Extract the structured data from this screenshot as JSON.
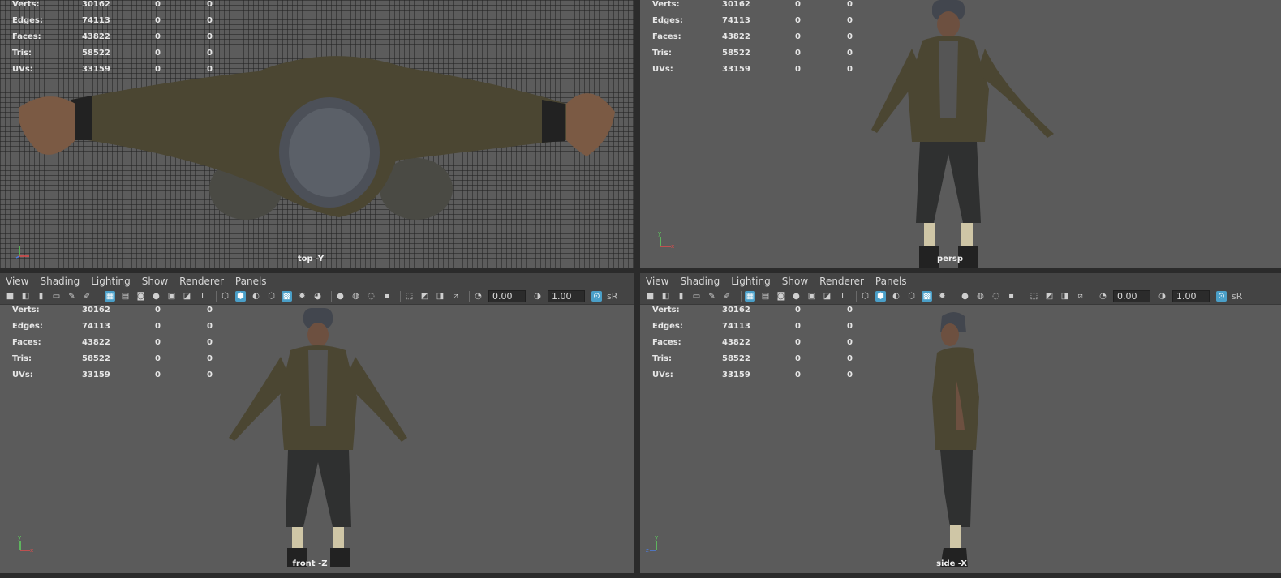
{
  "stats": [
    {
      "label": "Verts:",
      "v1": "30162",
      "v2": "0",
      "v3": "0"
    },
    {
      "label": "Edges:",
      "v1": "74113",
      "v2": "0",
      "v3": "0"
    },
    {
      "label": "Faces:",
      "v1": "43822",
      "v2": "0",
      "v3": "0"
    },
    {
      "label": "Tris:",
      "v1": "58522",
      "v2": "0",
      "v3": "0"
    },
    {
      "label": "UVs:",
      "v1": "33159",
      "v2": "0",
      "v3": "0"
    }
  ],
  "cameras": {
    "top": "top -Y",
    "persp": "persp",
    "front": "front -Z",
    "side": "side -X"
  },
  "menu": {
    "view": "View",
    "shading": "Shading",
    "lighting": "Lighting",
    "show": "Show",
    "renderer": "Renderer",
    "panels": "Panels"
  },
  "toolbar": {
    "exposure": "0.00",
    "gamma": "1.00",
    "color_mode": "sR"
  },
  "axis": {
    "x": "x",
    "y": "y",
    "z": "z"
  },
  "colors": {
    "viewport_bg": "#5b5b5b",
    "panel_bg": "#444444",
    "accent": "#4a9fc8"
  }
}
